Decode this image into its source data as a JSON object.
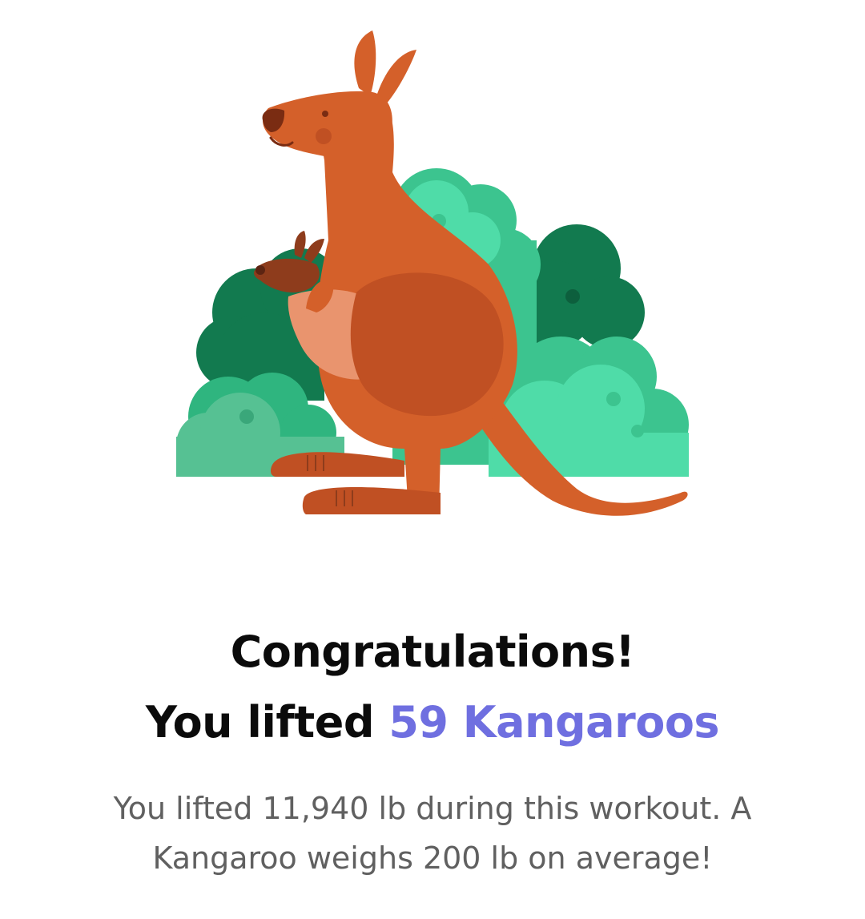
{
  "achievement": {
    "title": "Congratulations!",
    "lifted_prefix": "You lifted",
    "animal_count": "59 Kangaroos",
    "description": "You lifted 11,940 lb during this workout. A Kangaroo weighs 200 lb on average!"
  },
  "illustration": {
    "icon": "kangaroo-illustration",
    "colors": {
      "kangaroo": "#d4602a",
      "kangaroo_dark": "#c05023",
      "pouch": "#e9946e",
      "joey": "#8e3c1c",
      "bush_dark": "#127a4f",
      "bush_mid": "#2fb57f",
      "bush_light": "#4fdca8"
    }
  },
  "accent_color": "#6f6fe0"
}
